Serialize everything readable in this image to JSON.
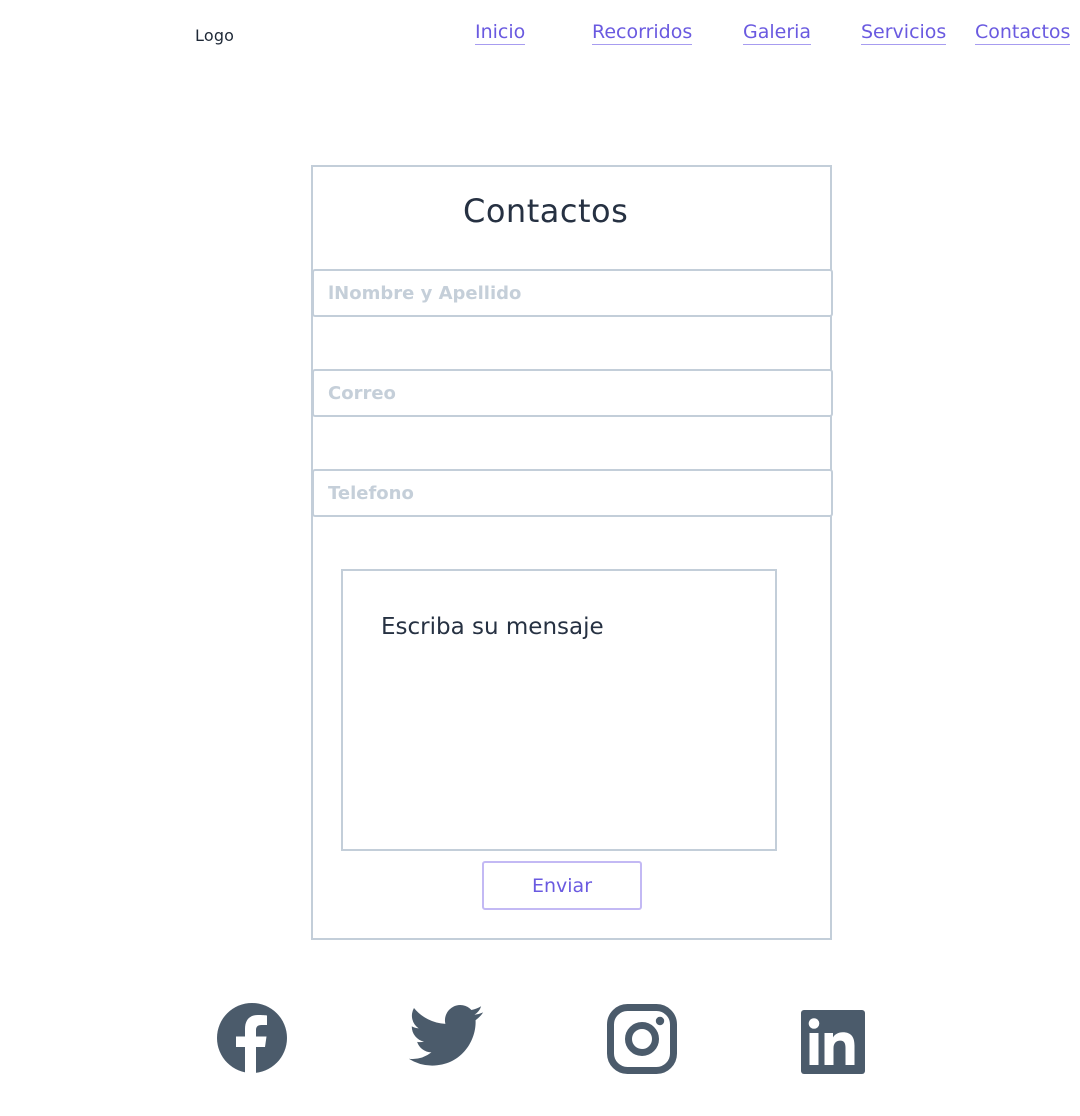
{
  "header": {
    "logo": "Logo",
    "nav": [
      {
        "label": "Inicio"
      },
      {
        "label": "Recorridos"
      },
      {
        "label": "Galeria"
      },
      {
        "label": "Servicios"
      },
      {
        "label": "Contactos"
      }
    ]
  },
  "form": {
    "title": "Contactos",
    "name_placeholder": "lNombre y Apellido",
    "name_value": "",
    "email_placeholder": "Correo",
    "email_value": "",
    "phone_placeholder": "Telefono",
    "phone_value": "",
    "message_text": "Escriba su mensaje",
    "submit_label": "Enviar"
  },
  "social": [
    {
      "icon": "facebook-icon"
    },
    {
      "icon": "twitter-icon"
    },
    {
      "icon": "instagram-icon"
    },
    {
      "icon": "linkedin-icon"
    }
  ],
  "colors": {
    "accent": "#6a5ae0",
    "border": "#c3ced9",
    "text": "#263142",
    "icon": "#4b5b6b"
  }
}
